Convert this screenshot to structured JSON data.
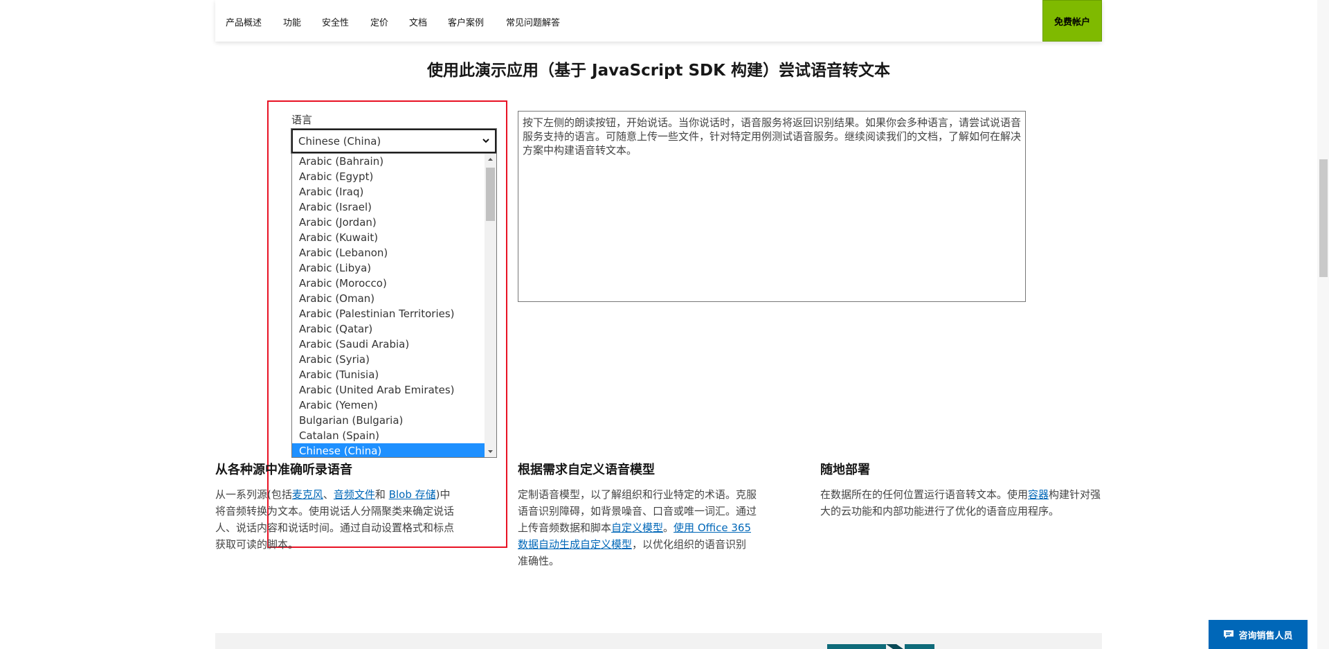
{
  "nav": {
    "items": [
      "产品概述",
      "功能",
      "安全性",
      "定价",
      "文档",
      "客户案例",
      "常见问题解答"
    ],
    "cta_label": "免费帐户"
  },
  "demo": {
    "title": "使用此演示应用（基于 JavaScript SDK 构建）尝试语音转文本",
    "language_label": "语言",
    "selected_language": "Chinese (China)",
    "options": [
      "Arabic (Bahrain)",
      "Arabic (Egypt)",
      "Arabic (Iraq)",
      "Arabic (Israel)",
      "Arabic (Jordan)",
      "Arabic (Kuwait)",
      "Arabic (Lebanon)",
      "Arabic (Libya)",
      "Arabic (Morocco)",
      "Arabic (Oman)",
      "Arabic (Palestinian Territories)",
      "Arabic (Qatar)",
      "Arabic (Saudi Arabia)",
      "Arabic (Syria)",
      "Arabic (Tunisia)",
      "Arabic (United Arab Emirates)",
      "Arabic (Yemen)",
      "Bulgarian (Bulgaria)",
      "Catalan (Spain)",
      "Chinese (China)"
    ],
    "transcript_text": "按下左侧的朗读按钮，开始说话。当你说话时，语音服务将返回识别结果。如果你会多种语言，请尝试说语音服务支持的语言。可随意上传一些文件，针对特定用例测试语音服务。继续阅读我们的文档，了解如何在解决方案中构建语音转文本。"
  },
  "features": {
    "f1": {
      "title": "从各种源中准确听录语音",
      "t1": "从一系列源(包括",
      "l1": "麦克风",
      "t2": "、",
      "l2": "音频文件",
      "t3": "和 ",
      "l3": "Blob 存储",
      "t4": ")中将音频转换为文本。使用说话人分隔聚类来确定说话人、说话内容和说话时间。通过自动设置格式和标点获取可读的脚本。"
    },
    "f2": {
      "title": "根据需求自定义语音模型",
      "t1": "定制语音模型，以了解组织和行业特定的术语。克服语音识别障碍，如背景噪音、口音或唯一词汇。通过上传音频数据和脚本",
      "l1": "自定义模型",
      "t2": "。",
      "l2": "使用 Office 365 数据自动生成自定义模型",
      "t3": "，以优化组织的语音识别准确性。"
    },
    "f3": {
      "title": "随地部署",
      "t1": "在数据所在的任何位置运行语音转文本。使用",
      "l1": "容器",
      "t2": "构建针对强大的云功能和内部功能进行了优化的语音应用程序。"
    }
  },
  "contact": {
    "label": "咨询销售人员",
    "icon": "chat-icon"
  },
  "colors": {
    "accent_green": "#7fba00",
    "link_blue": "#0067b8",
    "highlight_red": "#e81123",
    "selected_blue": "#1e90ff"
  }
}
